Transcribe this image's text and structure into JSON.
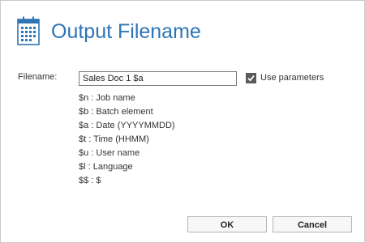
{
  "dialog": {
    "title": "Output Filename",
    "icon": "calendar-icon",
    "accent_color": "#2e75b6"
  },
  "filename": {
    "label": "Filename:",
    "value": "Sales Doc 1 $a"
  },
  "use_parameters": {
    "label": "Use parameters",
    "checked": true
  },
  "parameters": [
    "$n : Job name",
    "$b : Batch element",
    "$a : Date (YYYYMMDD)",
    "$t : Time (HHMM)",
    "$u : User name",
    "$l : Language",
    "$$ : $"
  ],
  "buttons": {
    "ok_label": "OK",
    "cancel_label": "Cancel"
  }
}
